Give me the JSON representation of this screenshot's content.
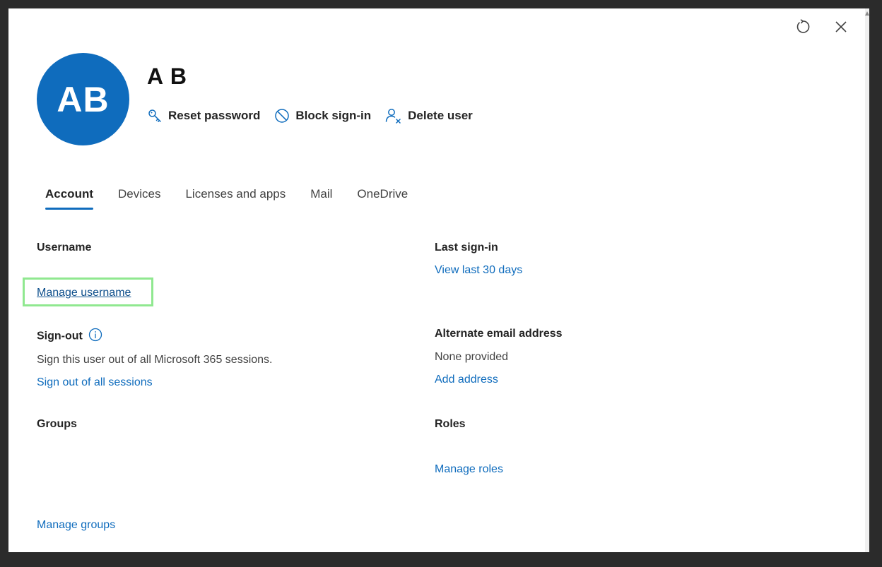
{
  "header": {
    "avatar_initials": "AB",
    "display_name": "A B",
    "actions": [
      {
        "label": "Reset password",
        "icon": "key-icon"
      },
      {
        "label": "Block sign-in",
        "icon": "block-icon"
      },
      {
        "label": "Delete user",
        "icon": "delete-user-icon"
      }
    ],
    "top_icons": [
      "refresh-icon",
      "close-icon"
    ]
  },
  "tabs": [
    {
      "label": "Account",
      "active": true
    },
    {
      "label": "Devices",
      "active": false
    },
    {
      "label": "Licenses and apps",
      "active": false
    },
    {
      "label": "Mail",
      "active": false
    },
    {
      "label": "OneDrive",
      "active": false
    }
  ],
  "account": {
    "username": {
      "label": "Username",
      "link": "Manage username"
    },
    "signout": {
      "label": "Sign-out",
      "description": "Sign this user out of all Microsoft 365 sessions.",
      "link": "Sign out of all sessions"
    },
    "groups": {
      "label": "Groups",
      "link": "Manage groups"
    },
    "last_signin": {
      "label": "Last sign-in",
      "link": "View last 30 days"
    },
    "alternate_email": {
      "label": "Alternate email address",
      "value": "None provided",
      "link": "Add address"
    },
    "roles": {
      "label": "Roles",
      "link": "Manage roles"
    }
  },
  "colors": {
    "accent": "#0f6cbd",
    "highlight": "#90e890"
  }
}
